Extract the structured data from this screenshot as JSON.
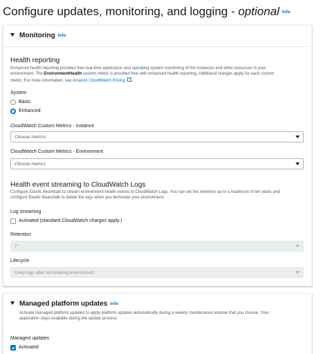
{
  "page": {
    "title": "Configure updates, monitoring, and logging - ",
    "title_optional": "optional",
    "info": "Info"
  },
  "monitoring": {
    "title": "Monitoring",
    "info": "Info",
    "health": {
      "heading": "Health reporting",
      "desc_1": "Enhanced health reporting provides free real-time application and operating system monitoring of the instances and other resources in your environment. The ",
      "desc_bold": "EnvironmentHealth",
      "desc_2": " custom metric is provided free with enhanced health reporting. Additional charges apply for each custom metric. For more information, see ",
      "pricing_link": "Amazon CloudWatch Pricing"
    },
    "system": {
      "label": "System",
      "options": [
        "Basic",
        "Enhanced"
      ],
      "selected": "Enhanced"
    },
    "instance_metrics": {
      "label": "CloudWatch Custom Metrics - Instance",
      "placeholder": "Choose metrics"
    },
    "environment_metrics": {
      "label": "CloudWatch Custom Metrics - Environment",
      "placeholder": "Choose metrics"
    },
    "streaming": {
      "heading": "Health event streaming to CloudWatch Logs",
      "desc": "Configure Elastic Beanstalk to stream environment health events to CloudWatch Logs. You can set the retention up to a maximum of ten years and configure Elastic Beanstalk to delete the logs when you terminate your environment.",
      "log_label": "Log streaming",
      "log_checkbox": "Activated (standard CloudWatch charges apply.)",
      "retention_label": "Retention",
      "retention_value": "7",
      "lifecycle_label": "Lifecycle",
      "lifecycle_value": "Keep logs after terminating environment"
    }
  },
  "managed": {
    "title": "Managed platform updates",
    "info": "Info",
    "desc": "Activate managed platform updates to apply platform updates automatically during a weekly maintenance window that you choose. Your application stays available during the update process.",
    "label": "Managed updates",
    "checkbox": "Activated"
  },
  "colors": {
    "link": "#0073bb",
    "text": "#16191f",
    "muted": "#545b64",
    "disabled": "#eaeded"
  }
}
